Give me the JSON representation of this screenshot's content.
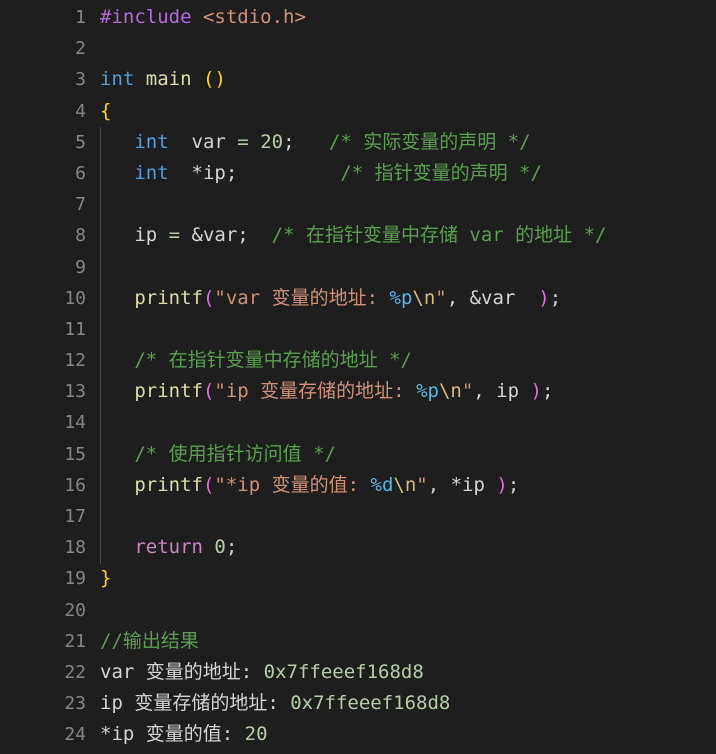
{
  "editor": {
    "theme_name": "dark-plus",
    "background_color": "#1e1e1e",
    "gutter_color": "#858585",
    "indent_guide_color": "#484848",
    "language": "c",
    "font_size_px": 19,
    "line_height_px": 31.2,
    "total_lines": 24,
    "colors": {
      "keyword": "#569cd6",
      "control": "#c586c0",
      "preprocessor": "#b06bd8",
      "header": "#ce9178",
      "function": "#dcdcaa",
      "paren_yellow": "#ffd700",
      "paren_magenta": "#da70d6",
      "brace": "#ffd700",
      "string": "#ce9178",
      "format_specifier": "#56b6e0",
      "escape": "#d7ba7d",
      "number": "#b5cea8",
      "comment": "#5a9e4f",
      "plain": "#d4d4d4"
    }
  },
  "lines": [
    {
      "number": "1",
      "indent": 0,
      "tokens": [
        {
          "text": "#include ",
          "cls": "t-preproc"
        },
        {
          "text": "<stdio.h>",
          "cls": "t-header"
        }
      ]
    },
    {
      "number": "2",
      "indent": 0,
      "tokens": []
    },
    {
      "number": "3",
      "indent": 0,
      "tokens": [
        {
          "text": "int",
          "cls": "t-keyword"
        },
        {
          "text": " ",
          "cls": "t-plain"
        },
        {
          "text": "main",
          "cls": "t-func"
        },
        {
          "text": " ",
          "cls": "t-plain"
        },
        {
          "text": "()",
          "cls": "t-paren-y"
        }
      ]
    },
    {
      "number": "4",
      "indent": 0,
      "tokens": [
        {
          "text": "{",
          "cls": "t-brace"
        }
      ]
    },
    {
      "number": "5",
      "indent": 1,
      "tokens": [
        {
          "text": "   ",
          "cls": "t-plain"
        },
        {
          "text": "int",
          "cls": "t-keyword"
        },
        {
          "text": "  var ",
          "cls": "t-plain"
        },
        {
          "text": "=",
          "cls": "t-op"
        },
        {
          "text": " ",
          "cls": "t-plain"
        },
        {
          "text": "20",
          "cls": "t-number"
        },
        {
          "text": ";",
          "cls": "t-plain"
        },
        {
          "text": "   ",
          "cls": "t-plain"
        },
        {
          "text": "/* 实际变量的声明 */",
          "cls": "t-comment"
        }
      ]
    },
    {
      "number": "6",
      "indent": 1,
      "tokens": [
        {
          "text": "   ",
          "cls": "t-plain"
        },
        {
          "text": "int",
          "cls": "t-keyword"
        },
        {
          "text": "  *ip;",
          "cls": "t-plain"
        },
        {
          "text": "         ",
          "cls": "t-plain"
        },
        {
          "text": "/* 指针变量的声明 */",
          "cls": "t-comment"
        }
      ]
    },
    {
      "number": "7",
      "indent": 1,
      "tokens": []
    },
    {
      "number": "8",
      "indent": 1,
      "tokens": [
        {
          "text": "   ip ",
          "cls": "t-plain"
        },
        {
          "text": "=",
          "cls": "t-op"
        },
        {
          "text": " &var;",
          "cls": "t-plain"
        },
        {
          "text": "  ",
          "cls": "t-plain"
        },
        {
          "text": "/* 在指针变量中存储 var 的地址 */",
          "cls": "t-comment"
        }
      ]
    },
    {
      "number": "9",
      "indent": 1,
      "tokens": []
    },
    {
      "number": "10",
      "indent": 1,
      "tokens": [
        {
          "text": "   ",
          "cls": "t-plain"
        },
        {
          "text": "printf",
          "cls": "t-func"
        },
        {
          "text": "(",
          "cls": "t-paren-m"
        },
        {
          "text": "\"var 变量的地址: ",
          "cls": "t-string"
        },
        {
          "text": "%p",
          "cls": "t-fmt"
        },
        {
          "text": "\\n",
          "cls": "t-esc"
        },
        {
          "text": "\"",
          "cls": "t-string"
        },
        {
          "text": ", &var  ",
          "cls": "t-plain"
        },
        {
          "text": ")",
          "cls": "t-paren-m"
        },
        {
          "text": ";",
          "cls": "t-plain"
        }
      ]
    },
    {
      "number": "11",
      "indent": 1,
      "tokens": []
    },
    {
      "number": "12",
      "indent": 1,
      "tokens": [
        {
          "text": "   ",
          "cls": "t-plain"
        },
        {
          "text": "/* 在指针变量中存储的地址 */",
          "cls": "t-comment"
        }
      ]
    },
    {
      "number": "13",
      "indent": 1,
      "tokens": [
        {
          "text": "   ",
          "cls": "t-plain"
        },
        {
          "text": "printf",
          "cls": "t-func"
        },
        {
          "text": "(",
          "cls": "t-paren-m"
        },
        {
          "text": "\"ip 变量存储的地址: ",
          "cls": "t-string"
        },
        {
          "text": "%p",
          "cls": "t-fmt"
        },
        {
          "text": "\\n",
          "cls": "t-esc"
        },
        {
          "text": "\"",
          "cls": "t-string"
        },
        {
          "text": ", ip ",
          "cls": "t-plain"
        },
        {
          "text": ")",
          "cls": "t-paren-m"
        },
        {
          "text": ";",
          "cls": "t-plain"
        }
      ]
    },
    {
      "number": "14",
      "indent": 1,
      "tokens": []
    },
    {
      "number": "15",
      "indent": 1,
      "tokens": [
        {
          "text": "   ",
          "cls": "t-plain"
        },
        {
          "text": "/* 使用指针访问值 */",
          "cls": "t-comment"
        }
      ]
    },
    {
      "number": "16",
      "indent": 1,
      "tokens": [
        {
          "text": "   ",
          "cls": "t-plain"
        },
        {
          "text": "printf",
          "cls": "t-func"
        },
        {
          "text": "(",
          "cls": "t-paren-m"
        },
        {
          "text": "\"*ip 变量的值: ",
          "cls": "t-string"
        },
        {
          "text": "%d",
          "cls": "t-fmt"
        },
        {
          "text": "\\n",
          "cls": "t-esc"
        },
        {
          "text": "\"",
          "cls": "t-string"
        },
        {
          "text": ", *ip ",
          "cls": "t-plain"
        },
        {
          "text": ")",
          "cls": "t-paren-m"
        },
        {
          "text": ";",
          "cls": "t-plain"
        }
      ]
    },
    {
      "number": "17",
      "indent": 1,
      "tokens": []
    },
    {
      "number": "18",
      "indent": 1,
      "tokens": [
        {
          "text": "   ",
          "cls": "t-plain"
        },
        {
          "text": "return",
          "cls": "t-ctrl"
        },
        {
          "text": " ",
          "cls": "t-plain"
        },
        {
          "text": "0",
          "cls": "t-number"
        },
        {
          "text": ";",
          "cls": "t-plain"
        }
      ]
    },
    {
      "number": "19",
      "indent": 0,
      "tokens": [
        {
          "text": "}",
          "cls": "t-brace"
        }
      ]
    },
    {
      "number": "20",
      "indent": 0,
      "tokens": []
    },
    {
      "number": "21",
      "indent": 0,
      "tokens": [
        {
          "text": "//输出结果",
          "cls": "t-comment"
        }
      ]
    },
    {
      "number": "22",
      "indent": 0,
      "tokens": [
        {
          "text": "var 变量的地址: ",
          "cls": "t-out"
        },
        {
          "text": "0x7ffeeef168d8",
          "cls": "t-hex"
        }
      ]
    },
    {
      "number": "23",
      "indent": 0,
      "tokens": [
        {
          "text": "ip 变量存储的地址: ",
          "cls": "t-out"
        },
        {
          "text": "0x7ffeeef168d8",
          "cls": "t-hex"
        }
      ]
    },
    {
      "number": "24",
      "indent": 0,
      "tokens": [
        {
          "text": "*ip 变量的值: ",
          "cls": "t-out"
        },
        {
          "text": "20",
          "cls": "t-hex"
        }
      ]
    }
  ],
  "indent_guides": [
    {
      "from_line": 5,
      "to_line": 18
    }
  ]
}
